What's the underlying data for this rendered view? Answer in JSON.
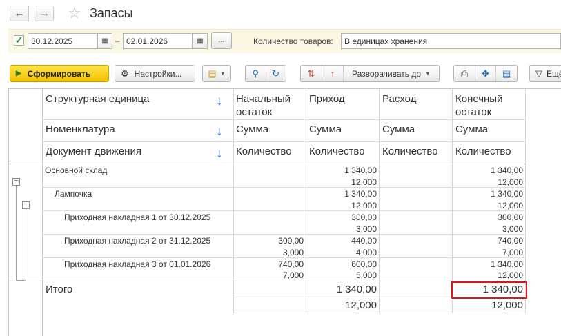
{
  "window": {
    "title": "Запасы"
  },
  "nav": {
    "back_icon": "arrow-left-icon",
    "forward_icon": "arrow-right-icon",
    "favorite_icon": "star-icon"
  },
  "params": {
    "period_enabled": "✓",
    "date_from": "30.12.2025",
    "date_separator": "–",
    "date_to": "02.01.2026",
    "more_label": "...",
    "quantity_label": "Количество товаров:",
    "quantity_value": "В единицах хранения"
  },
  "toolbar": {
    "generate_label": "Сформировать",
    "settings_label": "Настройки...",
    "expand_label": "Разворачивать до",
    "more_label": "Ещё"
  },
  "table": {
    "headers": {
      "row1": [
        "Структурная единица",
        "Начальный остаток",
        "Приход",
        "Расход",
        "Конечный остаток"
      ],
      "row2": [
        "Номенклатура",
        "Сумма",
        "Сумма",
        "Сумма",
        "Сумма"
      ],
      "row3": [
        "Документ движения",
        "Количество",
        "Количество",
        "Количество",
        "Количество"
      ]
    },
    "rows": [
      {
        "name": "Основной склад",
        "start_sum": "",
        "start_qty": "",
        "in_sum": "1 340,00",
        "in_qty": "12,000",
        "out_sum": "",
        "out_qty": "",
        "end_sum": "1 340,00",
        "end_qty": "12,000"
      },
      {
        "name": "Лампочка",
        "start_sum": "",
        "start_qty": "",
        "in_sum": "1 340,00",
        "in_qty": "12,000",
        "out_sum": "",
        "out_qty": "",
        "end_sum": "1 340,00",
        "end_qty": "12,000"
      },
      {
        "name": "Приходная накладная 1 от 30.12.2025",
        "start_sum": "",
        "start_qty": "",
        "in_sum": "300,00",
        "in_qty": "3,000",
        "out_sum": "",
        "out_qty": "",
        "end_sum": "300,00",
        "end_qty": "3,000"
      },
      {
        "name": "Приходная накладная 2 от 31.12.2025",
        "start_sum": "300,00",
        "start_qty": "3,000",
        "in_sum": "440,00",
        "in_qty": "4,000",
        "out_sum": "",
        "out_qty": "",
        "end_sum": "740,00",
        "end_qty": "7,000"
      },
      {
        "name": "Приходная накладная 3 от 01.01.2026",
        "start_sum": "740,00",
        "start_qty": "7,000",
        "in_sum": "600,00",
        "in_qty": "5,000",
        "out_sum": "",
        "out_qty": "",
        "end_sum": "1 340,00",
        "end_qty": "12,000"
      }
    ],
    "total": {
      "label": "Итого",
      "in_sum": "1 340,00",
      "in_qty": "12,000",
      "end_sum": "1 340,00",
      "end_qty": "12,000"
    }
  }
}
